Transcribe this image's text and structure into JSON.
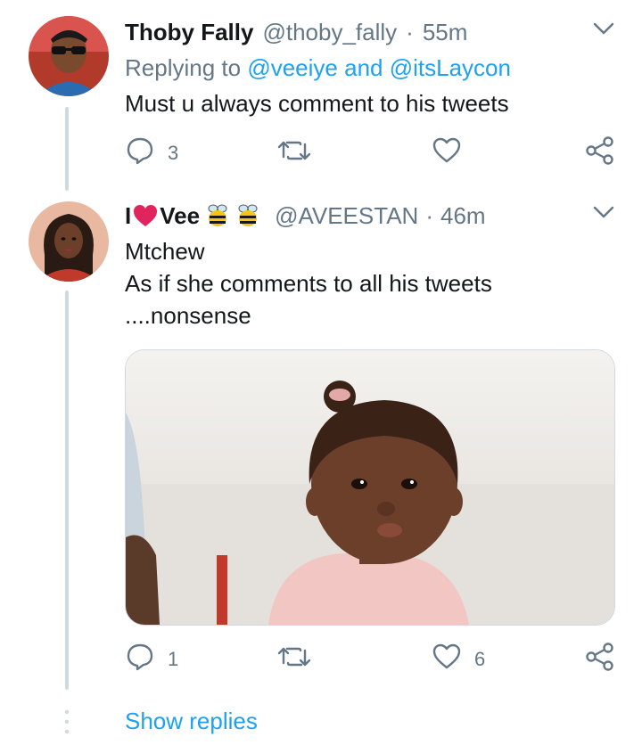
{
  "tweets": [
    {
      "name": "Thoby Fally",
      "handle": "@thoby_fally",
      "dot": "·",
      "time": "55m",
      "reply_prefix": "Replying to",
      "reply_mentions_1": "@veeiye",
      "reply_and": "and",
      "reply_mentions_2": "@itsLaycon",
      "text_lines": [
        "Must u always comment to his tweets"
      ],
      "replies": "3",
      "retweets": "",
      "likes": "",
      "avatar_icon": "person-sunglasses-avatar"
    },
    {
      "name_prefix": "I",
      "name_suffix": "Vee",
      "handle": "@AVEESTAN",
      "dot": "·",
      "time": "46m",
      "text_lines": [
        "Mtchew",
        "As if she comments to all his tweets",
        "....nonsense"
      ],
      "replies": "1",
      "retweets": "",
      "likes": "6",
      "avatar_icon": "woman-avatar",
      "media_icon": "toddler-photo"
    }
  ],
  "footer": {
    "show_replies": "Show replies"
  },
  "colors": {
    "accent": "#1da1f2",
    "muted": "#657786",
    "heart_red": "#e0245e",
    "thread_line": "#cfd9de"
  }
}
